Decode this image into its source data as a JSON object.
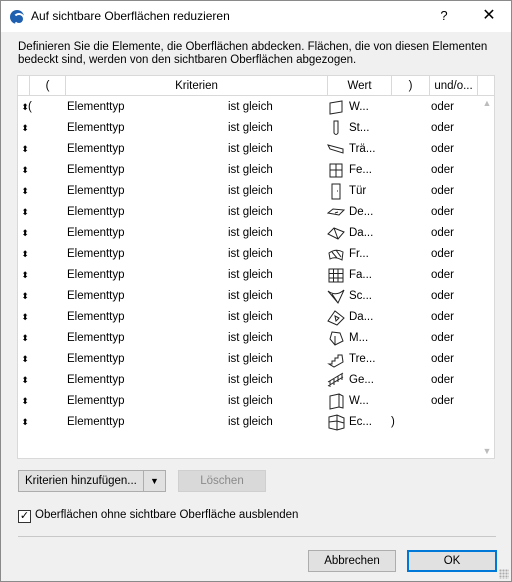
{
  "window": {
    "title": "Auf sichtbare Oberflächen reduzieren",
    "help": "?",
    "close": "✕"
  },
  "intro": "Definieren Sie die Elemente, die Oberflächen abdecken. Flächen, die von diesen Elementen bedeckt sind, werden von den sichtbaren Oberflächen abgezogen.",
  "columns": {
    "open": "(",
    "criteria": "Kriterien",
    "value": "Wert",
    "close": ")",
    "andor": "und/o..."
  },
  "rows": [
    {
      "open": "(",
      "type": "Elementtyp",
      "op": "ist gleich",
      "icon": "wall-icon",
      "value": "W...",
      "close": "",
      "andor": "oder"
    },
    {
      "open": "",
      "type": "Elementtyp",
      "op": "ist gleich",
      "icon": "column-icon",
      "value": "St...",
      "close": "",
      "andor": "oder"
    },
    {
      "open": "",
      "type": "Elementtyp",
      "op": "ist gleich",
      "icon": "beam-icon",
      "value": "Trä...",
      "close": "",
      "andor": "oder"
    },
    {
      "open": "",
      "type": "Elementtyp",
      "op": "ist gleich",
      "icon": "window-icon",
      "value": "Fe...",
      "close": "",
      "andor": "oder"
    },
    {
      "open": "",
      "type": "Elementtyp",
      "op": "ist gleich",
      "icon": "door-icon",
      "value": "Tür",
      "close": "",
      "andor": "oder"
    },
    {
      "open": "",
      "type": "Elementtyp",
      "op": "ist gleich",
      "icon": "slab-icon",
      "value": "De...",
      "close": "",
      "andor": "oder"
    },
    {
      "open": "",
      "type": "Elementtyp",
      "op": "ist gleich",
      "icon": "roof-icon",
      "value": "Da...",
      "close": "",
      "andor": "oder"
    },
    {
      "open": "",
      "type": "Elementtyp",
      "op": "ist gleich",
      "icon": "freeform-icon",
      "value": "Fr...",
      "close": "",
      "andor": "oder"
    },
    {
      "open": "",
      "type": "Elementtyp",
      "op": "ist gleich",
      "icon": "curtain-wall-icon",
      "value": "Fa...",
      "close": "",
      "andor": "oder"
    },
    {
      "open": "",
      "type": "Elementtyp",
      "op": "ist gleich",
      "icon": "shell-icon",
      "value": "Sc...",
      "close": "",
      "andor": "oder"
    },
    {
      "open": "",
      "type": "Elementtyp",
      "op": "ist gleich",
      "icon": "skylight-icon",
      "value": "Da...",
      "close": "",
      "andor": "oder"
    },
    {
      "open": "",
      "type": "Elementtyp",
      "op": "ist gleich",
      "icon": "morph-icon",
      "value": "M...",
      "close": "",
      "andor": "oder"
    },
    {
      "open": "",
      "type": "Elementtyp",
      "op": "ist gleich",
      "icon": "stair-icon",
      "value": "Tre...",
      "close": "",
      "andor": "oder"
    },
    {
      "open": "",
      "type": "Elementtyp",
      "op": "ist gleich",
      "icon": "railing-icon",
      "value": "Ge...",
      "close": "",
      "andor": "oder"
    },
    {
      "open": "",
      "type": "Elementtyp",
      "op": "ist gleich",
      "icon": "wall-end-icon",
      "value": "W...",
      "close": "",
      "andor": "oder"
    },
    {
      "open": "",
      "type": "Elementtyp",
      "op": "ist gleich",
      "icon": "corner-window-icon",
      "value": "Ec...",
      "close": ")",
      "andor": ""
    }
  ],
  "buttons": {
    "add": "Kriterien hinzufügen...",
    "delete": "Löschen",
    "cancel": "Abbrechen",
    "ok": "OK"
  },
  "checkbox": {
    "label": "Oberflächen ohne sichtbare Oberfläche ausblenden",
    "checked": true
  }
}
